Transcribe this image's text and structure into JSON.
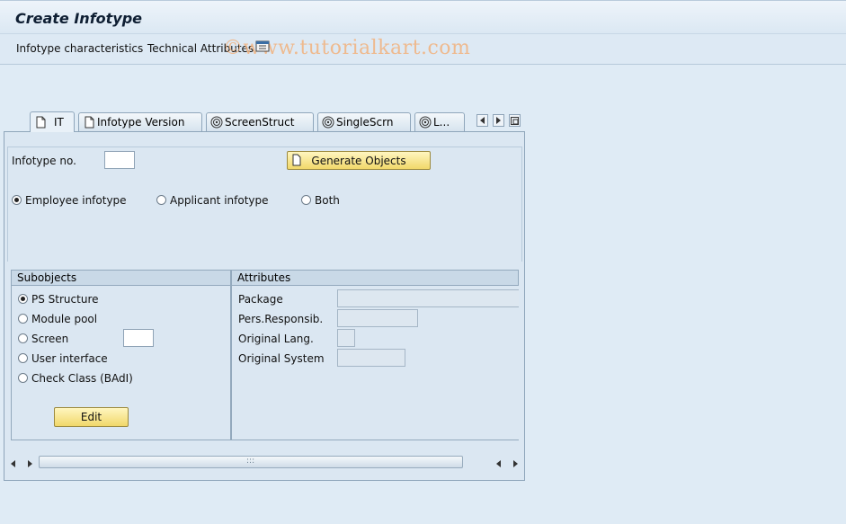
{
  "window": {
    "title": "Create Infotype"
  },
  "toolbar": {
    "infotype_characteristics": "Infotype characteristics",
    "technical_attributes": "Technical Attributes",
    "watermark": "©www.tutorialkart.com"
  },
  "tabs": [
    {
      "label": "IT",
      "icon": "document-icon",
      "active": true
    },
    {
      "label": "Infotype Version",
      "icon": "document-icon",
      "active": false
    },
    {
      "label": "ScreenStruct",
      "icon": "spiral-icon",
      "active": false
    },
    {
      "label": "SingleScrn",
      "icon": "spiral-icon",
      "active": false
    },
    {
      "label": "L...",
      "icon": "spiral-icon",
      "active": false
    }
  ],
  "header": {
    "infotype_no_label": "Infotype no.",
    "infotype_no_value": "",
    "generate_button": "Generate Objects",
    "radio_employee": "Employee infotype",
    "radio_applicant": "Applicant infotype",
    "radio_both": "Both",
    "selected_radio": "Employee infotype"
  },
  "subobjects": {
    "title": "Subobjects",
    "items": [
      "PS Structure",
      "Module pool",
      "Screen",
      "User interface",
      "Check Class (BAdI)"
    ],
    "selected": "PS Structure",
    "screen_value": "",
    "edit_button": "Edit"
  },
  "attributes": {
    "title": "Attributes",
    "package_label": "Package",
    "pers_responsib_label": "Pers.Responsib.",
    "original_lang_label": "Original Lang.",
    "original_system_label": "Original System",
    "package_value": "",
    "pers_responsib_value": "",
    "original_lang_value": "",
    "original_system_value": ""
  },
  "scrollbar": {
    "grip": ":::"
  },
  "colors": {
    "accent_button": "#f1d86a",
    "panel_bg": "#dbe7f2",
    "watermark": "#f2b27e"
  }
}
